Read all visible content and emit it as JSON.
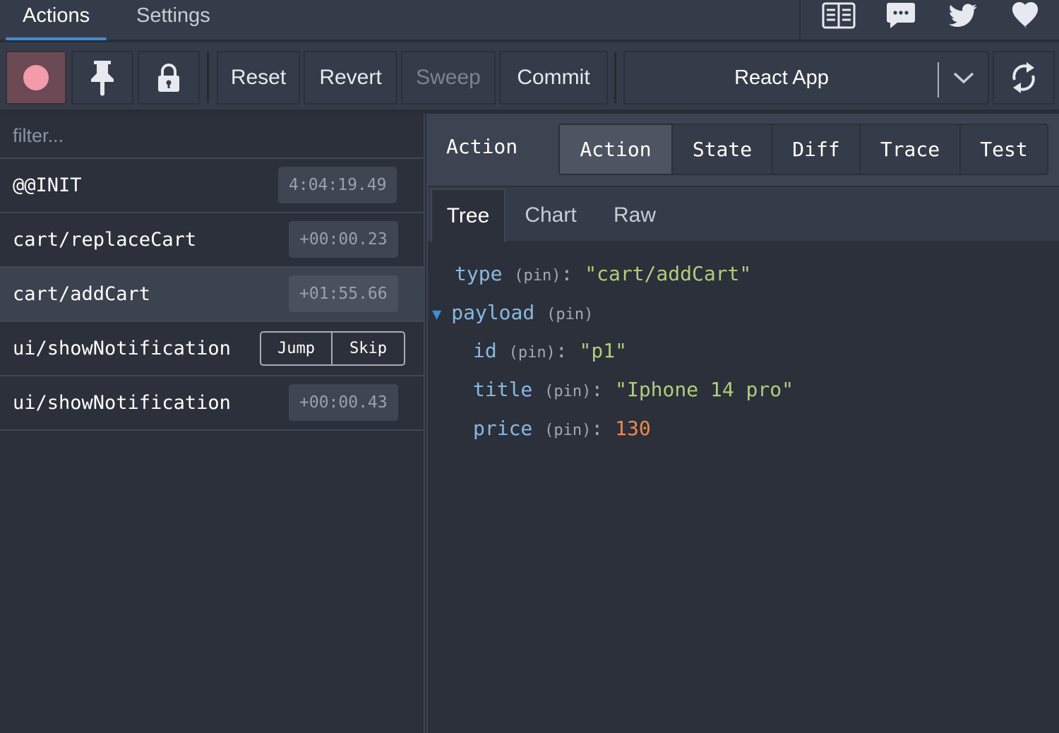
{
  "top_tabs": [
    "Actions",
    "Settings"
  ],
  "top_icons": [
    "book-icon",
    "chat-icon",
    "twitter-icon",
    "heart-icon"
  ],
  "toolbar": {
    "record_icon": "record-icon",
    "pin_icon": "pin-icon",
    "lock_icon": "lock-icon",
    "buttons": [
      "Reset",
      "Revert",
      "Sweep",
      "Commit"
    ],
    "instance": "React App",
    "chevron_icon": "chevron-down-icon",
    "sync_icon": "sync-icon"
  },
  "actions": {
    "filter_placeholder": "filter...",
    "items": [
      {
        "name": "@@INIT",
        "time": "4:04:19.49"
      },
      {
        "name": "cart/replaceCart",
        "time": "+00:00.23"
      },
      {
        "name": "cart/addCart",
        "time": "+01:55.66"
      },
      {
        "name": "ui/showNotification",
        "jump": "Jump",
        "skip": "Skip"
      },
      {
        "name": "ui/showNotification",
        "time": "+00:00.43"
      }
    ]
  },
  "inspector": {
    "title": "Action",
    "tabs": [
      "Action",
      "State",
      "Diff",
      "Trace",
      "Test"
    ],
    "subtabs": [
      "Tree",
      "Chart",
      "Raw"
    ],
    "tree": {
      "type_key": "type",
      "type_value": "\"cart/addCart\"",
      "payload_key": "payload",
      "pin": "(pin)",
      "colon": ":",
      "expand_glyph": "▼",
      "fields": [
        {
          "key": "id",
          "value": "\"p1\""
        },
        {
          "key": "title",
          "value": "\"Iphone 14 pro\""
        },
        {
          "key": "price",
          "value": "130"
        }
      ]
    }
  },
  "colors": {
    "accent": "#3b8ed8",
    "record": "#f39bab",
    "string": "#b3cc7a",
    "number": "#f08a4b",
    "key": "#89b8e0"
  }
}
